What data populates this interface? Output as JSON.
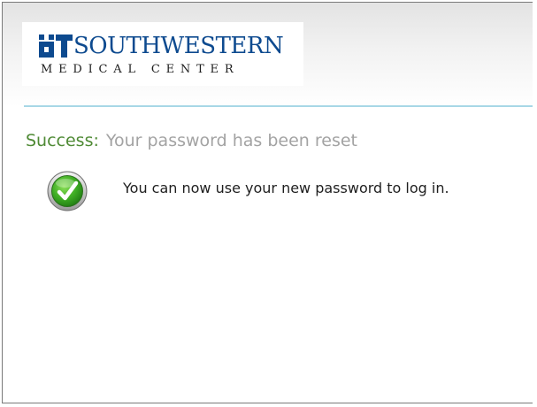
{
  "logo": {
    "ut_mark": "UT",
    "name": "SOUTHWESTERN",
    "subtitle": "MEDICAL CENTER"
  },
  "status": {
    "label": "Success:",
    "message": "Your password has been reset"
  },
  "info": {
    "icon": "check-icon",
    "text": "You can now use your new password to log in."
  },
  "colors": {
    "brand_blue": "#0d4a8f",
    "success_green": "#4f8a35",
    "divider": "#a7d7e6"
  }
}
